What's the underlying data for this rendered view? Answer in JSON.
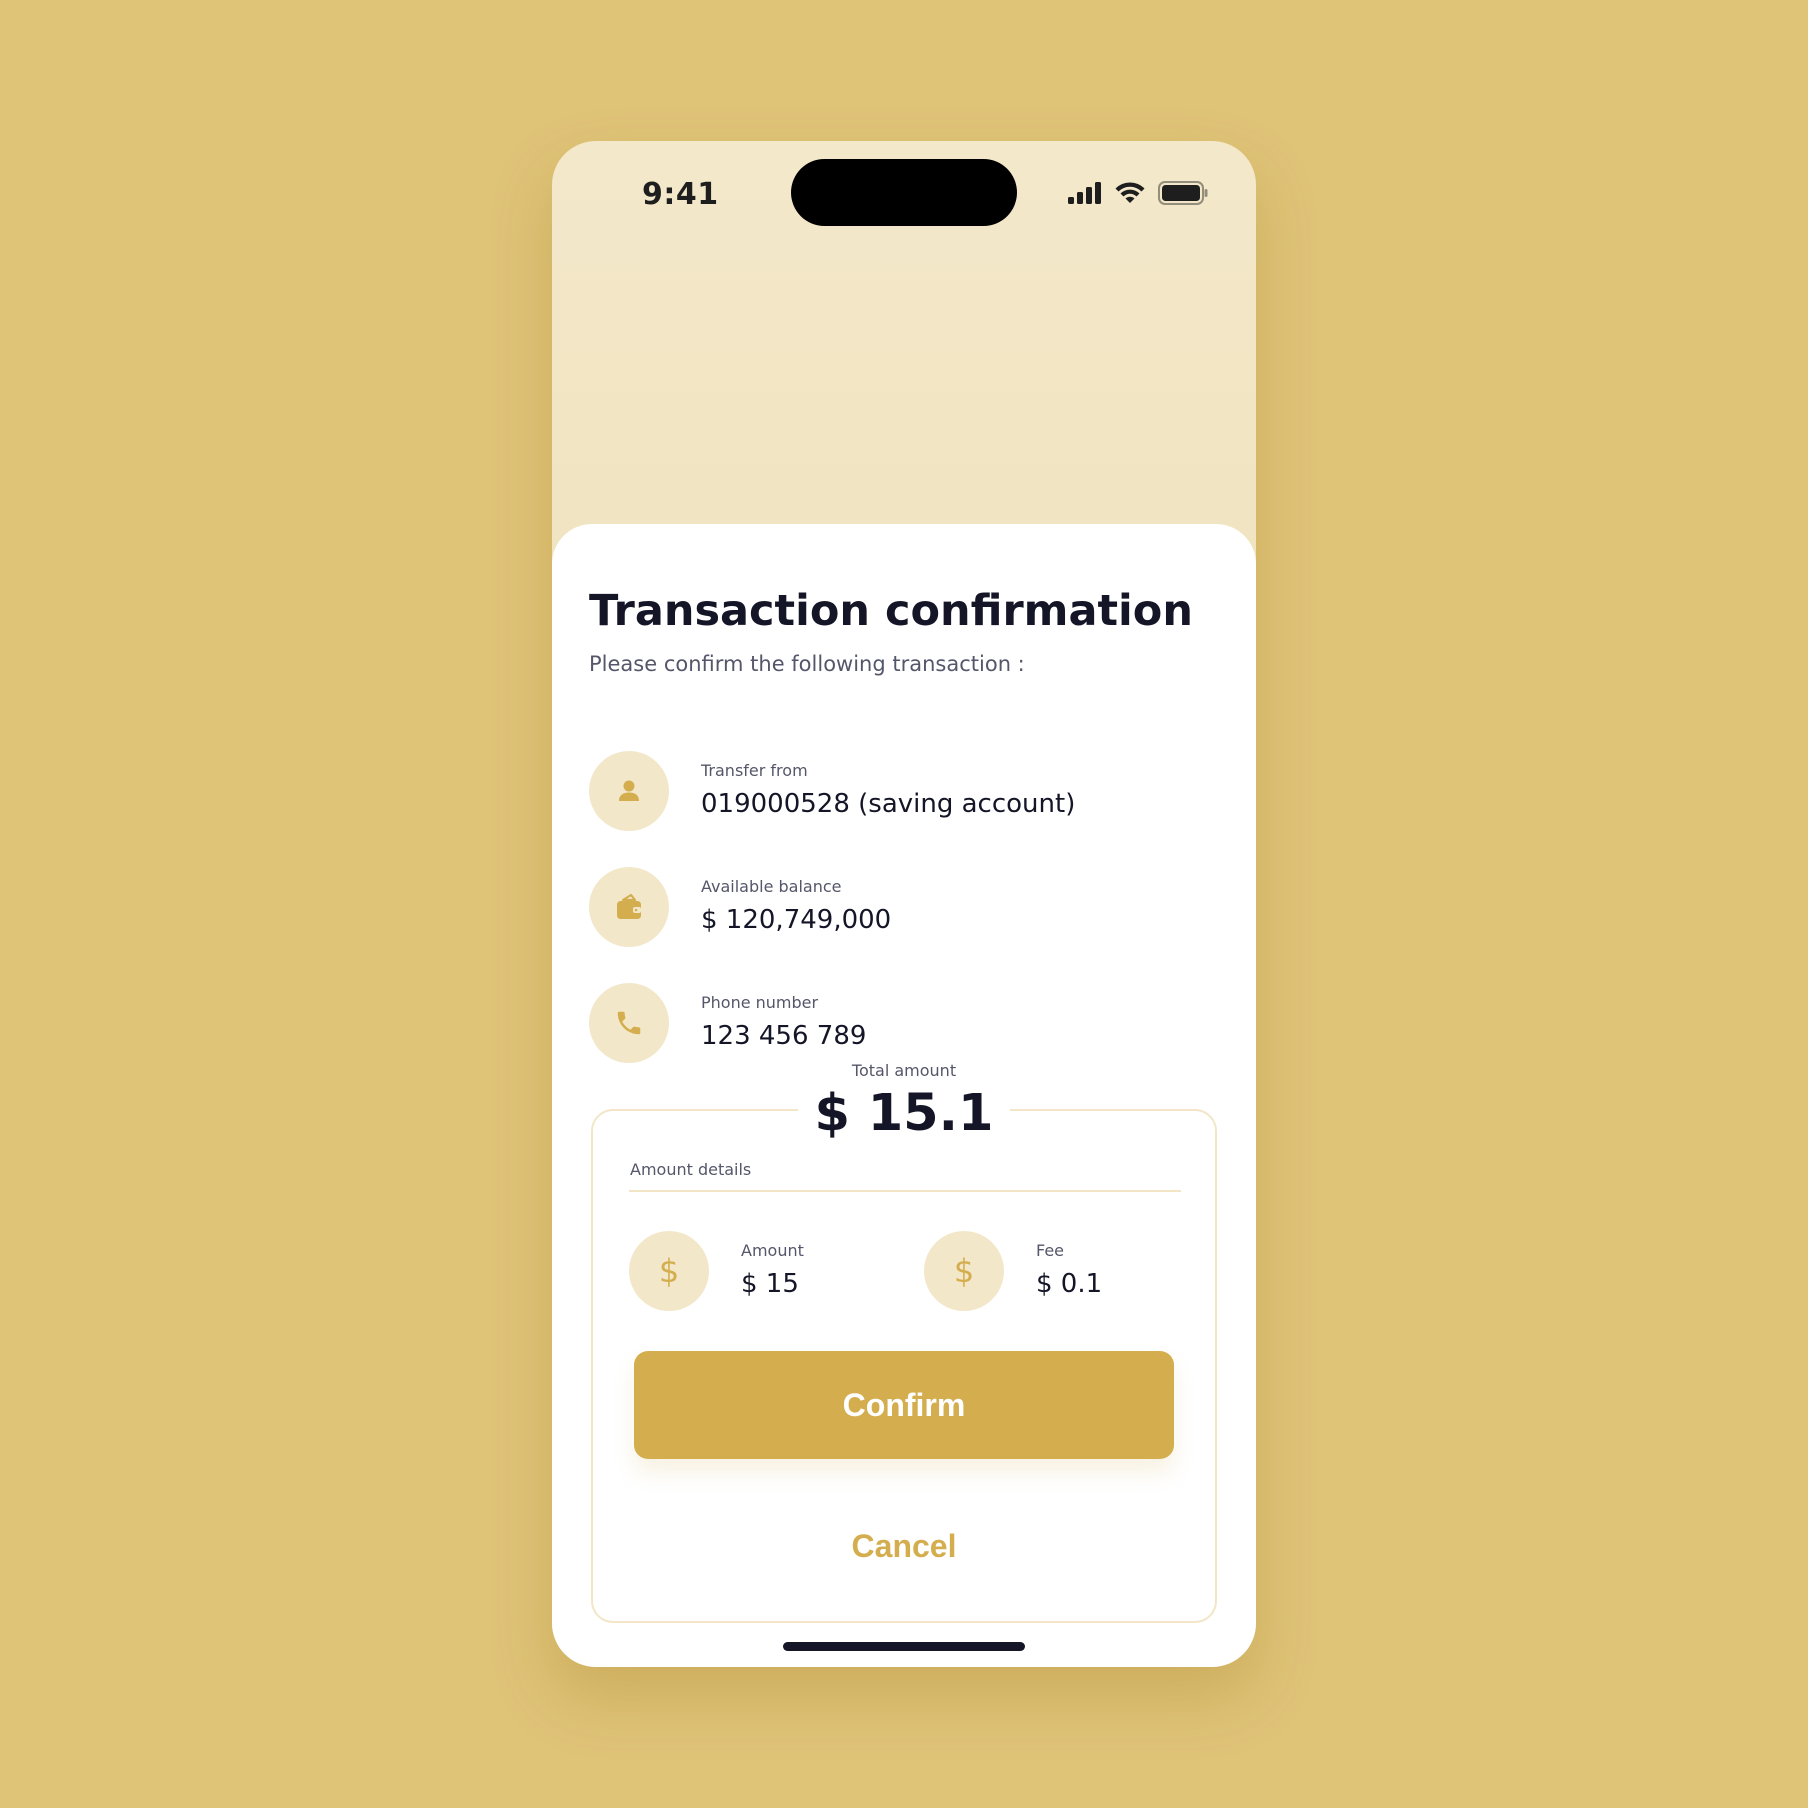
{
  "status_bar": {
    "time": "9:41",
    "icons": [
      "cellular-signal-icon",
      "wifi-icon",
      "battery-icon"
    ]
  },
  "sheet": {
    "title": "Transaction confirmation",
    "subtitle": "Please confirm the following transaction :",
    "details": [
      {
        "icon": "user-icon",
        "label": "Transfer from",
        "value": "019000528 (saving account)"
      },
      {
        "icon": "wallet-icon",
        "label": "Available balance",
        "value": "$ 120,749,000"
      },
      {
        "icon": "phone-icon",
        "label": "Phone number",
        "value": "123 456 789"
      }
    ],
    "total": {
      "label": "Total amount",
      "value": "$ 15.1"
    },
    "amount_details": {
      "label": "Amount details",
      "items": [
        {
          "icon": "dollar-icon",
          "icon_glyph": "$",
          "label": "Amount",
          "value": "$ 15"
        },
        {
          "icon": "dollar-icon",
          "icon_glyph": "$",
          "label": "Fee",
          "value": "$ 0.1"
        }
      ]
    },
    "actions": {
      "confirm_label": "Confirm",
      "cancel_label": "Cancel"
    }
  },
  "colors": {
    "background": "#DFC377",
    "accent": "#D4AE4E",
    "icon_circle": "#F3E7C9",
    "text_primary": "#141527",
    "text_secondary": "#55566A"
  }
}
